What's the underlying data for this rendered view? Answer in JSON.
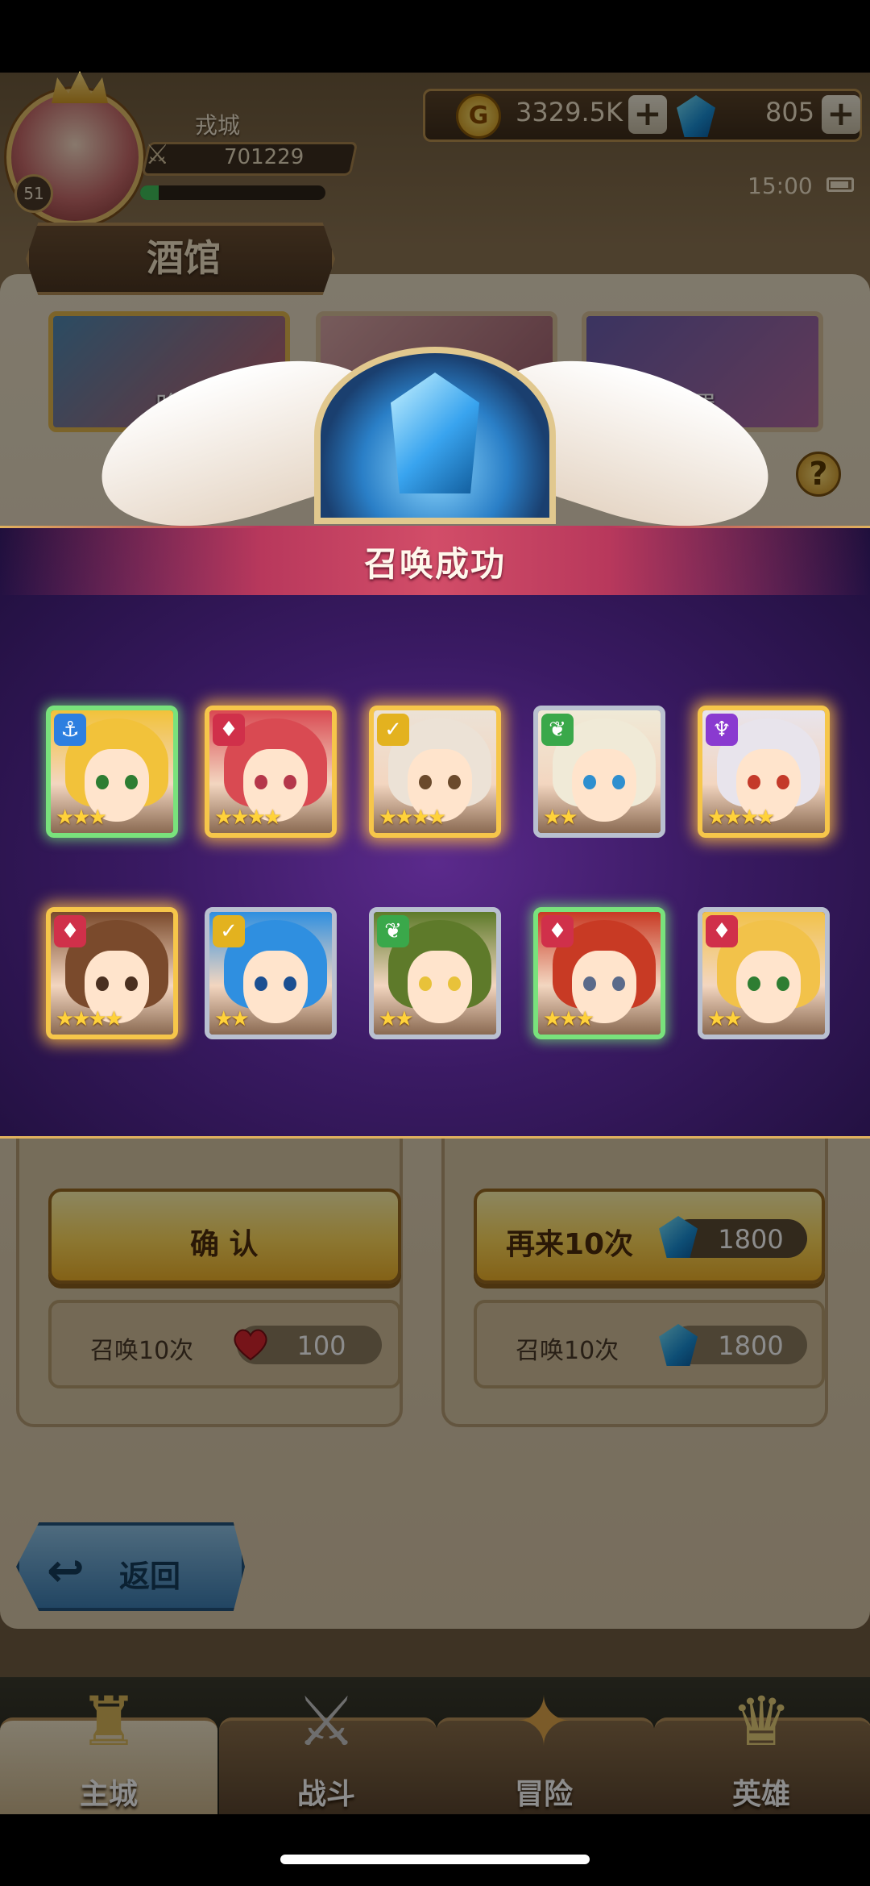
{
  "player": {
    "name": "戎城",
    "level": "51",
    "power": "701229",
    "exp_fraction": 0.1
  },
  "currency": {
    "gold": "3329.5K",
    "gems": "805",
    "plus_label": "+"
  },
  "clock": "15:00",
  "tavern": {
    "title": "酒馆",
    "banners": [
      {
        "label": "晚"
      },
      {
        "label": ""
      },
      {
        "label": "置"
      }
    ],
    "help_label": "?"
  },
  "modal": {
    "title": "召唤成功",
    "heroes": [
      {
        "element": "anchor",
        "element_glyph": "⚓",
        "element_color": "#2d7fe0",
        "stars": 3,
        "rarity": "green",
        "hair": "#f2c23a",
        "eye": "#2e7d32"
      },
      {
        "element": "fire",
        "element_glyph": "♦",
        "element_color": "#d0304a",
        "stars": 4,
        "rarity": "gold",
        "hair": "#d94a52",
        "eye": "#b5374a"
      },
      {
        "element": "light",
        "element_glyph": "✓",
        "element_color": "#e3b21f",
        "stars": 4,
        "rarity": "gold",
        "hair": "#ece2d6",
        "eye": "#6b4a2c"
      },
      {
        "element": "nature",
        "element_glyph": "❦",
        "element_color": "#3aa84a",
        "stars": 2,
        "rarity": "silver",
        "hair": "#f0ead7",
        "eye": "#2e8fcf"
      },
      {
        "element": "dark",
        "element_glyph": "♆",
        "element_color": "#8a3ad0",
        "stars": 4,
        "rarity": "gold",
        "hair": "#e8e4ec",
        "eye": "#c43a2a"
      },
      {
        "element": "fire",
        "element_glyph": "♦",
        "element_color": "#d0304a",
        "stars": 4,
        "rarity": "gold",
        "hair": "#7a4a2c",
        "eye": "#4a3020"
      },
      {
        "element": "light",
        "element_glyph": "✓",
        "element_color": "#e3b21f",
        "stars": 2,
        "rarity": "silver",
        "hair": "#2f8fe0",
        "eye": "#1b4f91"
      },
      {
        "element": "nature",
        "element_glyph": "❦",
        "element_color": "#3aa84a",
        "stars": 2,
        "rarity": "silver",
        "hair": "#5e7a2a",
        "eye": "#e8c23a"
      },
      {
        "element": "fire",
        "element_glyph": "♦",
        "element_color": "#d0304a",
        "stars": 3,
        "rarity": "green",
        "hair": "#c83a24",
        "eye": "#5a6a8a"
      },
      {
        "element": "fire",
        "element_glyph": "♦",
        "element_color": "#d0304a",
        "stars": 2,
        "rarity": "silver",
        "hair": "#f2c24a",
        "eye": "#2e7d32"
      }
    ]
  },
  "cards": {
    "confirm_label": "确 认",
    "again_label": "再来10次",
    "again_cost": "1800",
    "left_summon_label": "召唤10次",
    "left_summon_cost": "100",
    "right_summon_label": "召唤10次",
    "right_summon_cost": "1800"
  },
  "back_label": "返回",
  "nav": {
    "tabs": [
      {
        "label": "主城",
        "icon": "castle-icon",
        "glyph": "♜"
      },
      {
        "label": "战斗",
        "icon": "crossed-swords-icon",
        "glyph": "⚔"
      },
      {
        "label": "冒险",
        "icon": "compass-icon",
        "glyph": "✦"
      },
      {
        "label": "英雄",
        "icon": "helmet-icon",
        "glyph": "♛"
      }
    ]
  }
}
